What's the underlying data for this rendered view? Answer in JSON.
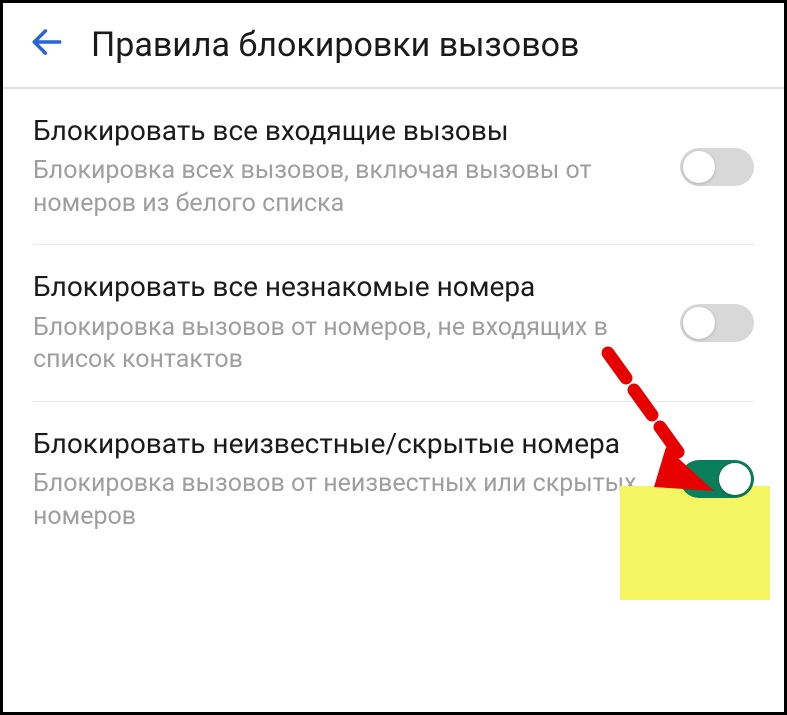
{
  "header": {
    "title": "Правила блокировки вызовов"
  },
  "settings": [
    {
      "title": "Блокировать все входящие вызовы",
      "desc": "Блокировка всех вызовов, включая вызовы от номеров из белого списка",
      "enabled": false
    },
    {
      "title": "Блокировать все незнакомые номера",
      "desc": "Блокировка вызовов от номеров, не входящих в список контактов",
      "enabled": false
    },
    {
      "title": "Блокировать неизвестные/скрытые номера",
      "desc": "Блокировка вызовов от неизвестных или скрытых номеров",
      "enabled": true
    }
  ],
  "colors": {
    "toggle_on": "#0a7d5a",
    "toggle_off": "#d8d8d8",
    "accent": "#2962d9",
    "highlight": "#f5f564",
    "arrow": "#e60000"
  }
}
